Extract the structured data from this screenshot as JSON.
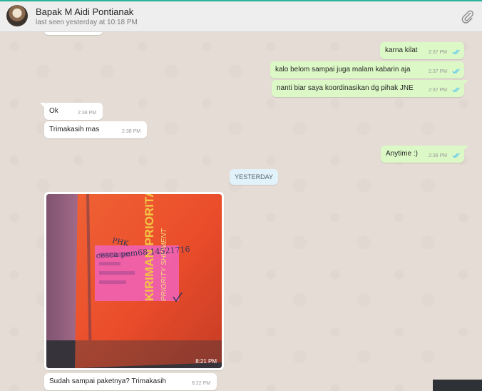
{
  "header": {
    "contact_name": "Bapak M Aidi Pontianak",
    "last_seen": "last seen yesterday at 10:18 PM",
    "attach_icon": "paperclip-icon"
  },
  "colors": {
    "chat_background": "#e5ddd5",
    "outgoing_bubble": "#dcf8c6",
    "incoming_bubble": "#ffffff",
    "read_ticks": "#4fc3f7",
    "date_chip": "#e1f2fa"
  },
  "messages": [
    {
      "direction": "out",
      "text": "karna kilat",
      "time": "2:37 PM",
      "status": "read"
    },
    {
      "direction": "out",
      "text": "kalo belom sampai juga malam kabarin aja",
      "time": "2:37 PM",
      "status": "read"
    },
    {
      "direction": "out",
      "text": "nanti biar saya koordinasikan dg pihak JNE",
      "time": "2:37 PM",
      "status": "read"
    },
    {
      "direction": "in",
      "text": "Ok",
      "time": "2:38 PM"
    },
    {
      "direction": "in",
      "text": "Trimakasih mas",
      "time": "2:38 PM"
    },
    {
      "direction": "out",
      "text": "Anytime :)",
      "time": "2:38 PM",
      "status": "read"
    }
  ],
  "date_separator": "YESTERDAY",
  "image_message": {
    "direction": "in",
    "time": "8:21 PM",
    "photo_text": {
      "line1": "KIRIMAN PRIORITAS",
      "line2": "PRIORITY SHIPMENT",
      "handwriting_1": "PHK",
      "handwriting_2": "cesca pem68 14521716"
    }
  },
  "last_message": {
    "direction": "in",
    "text": "Sudah sampai paketnya? Trimakasih",
    "time": "8:22 PM"
  }
}
